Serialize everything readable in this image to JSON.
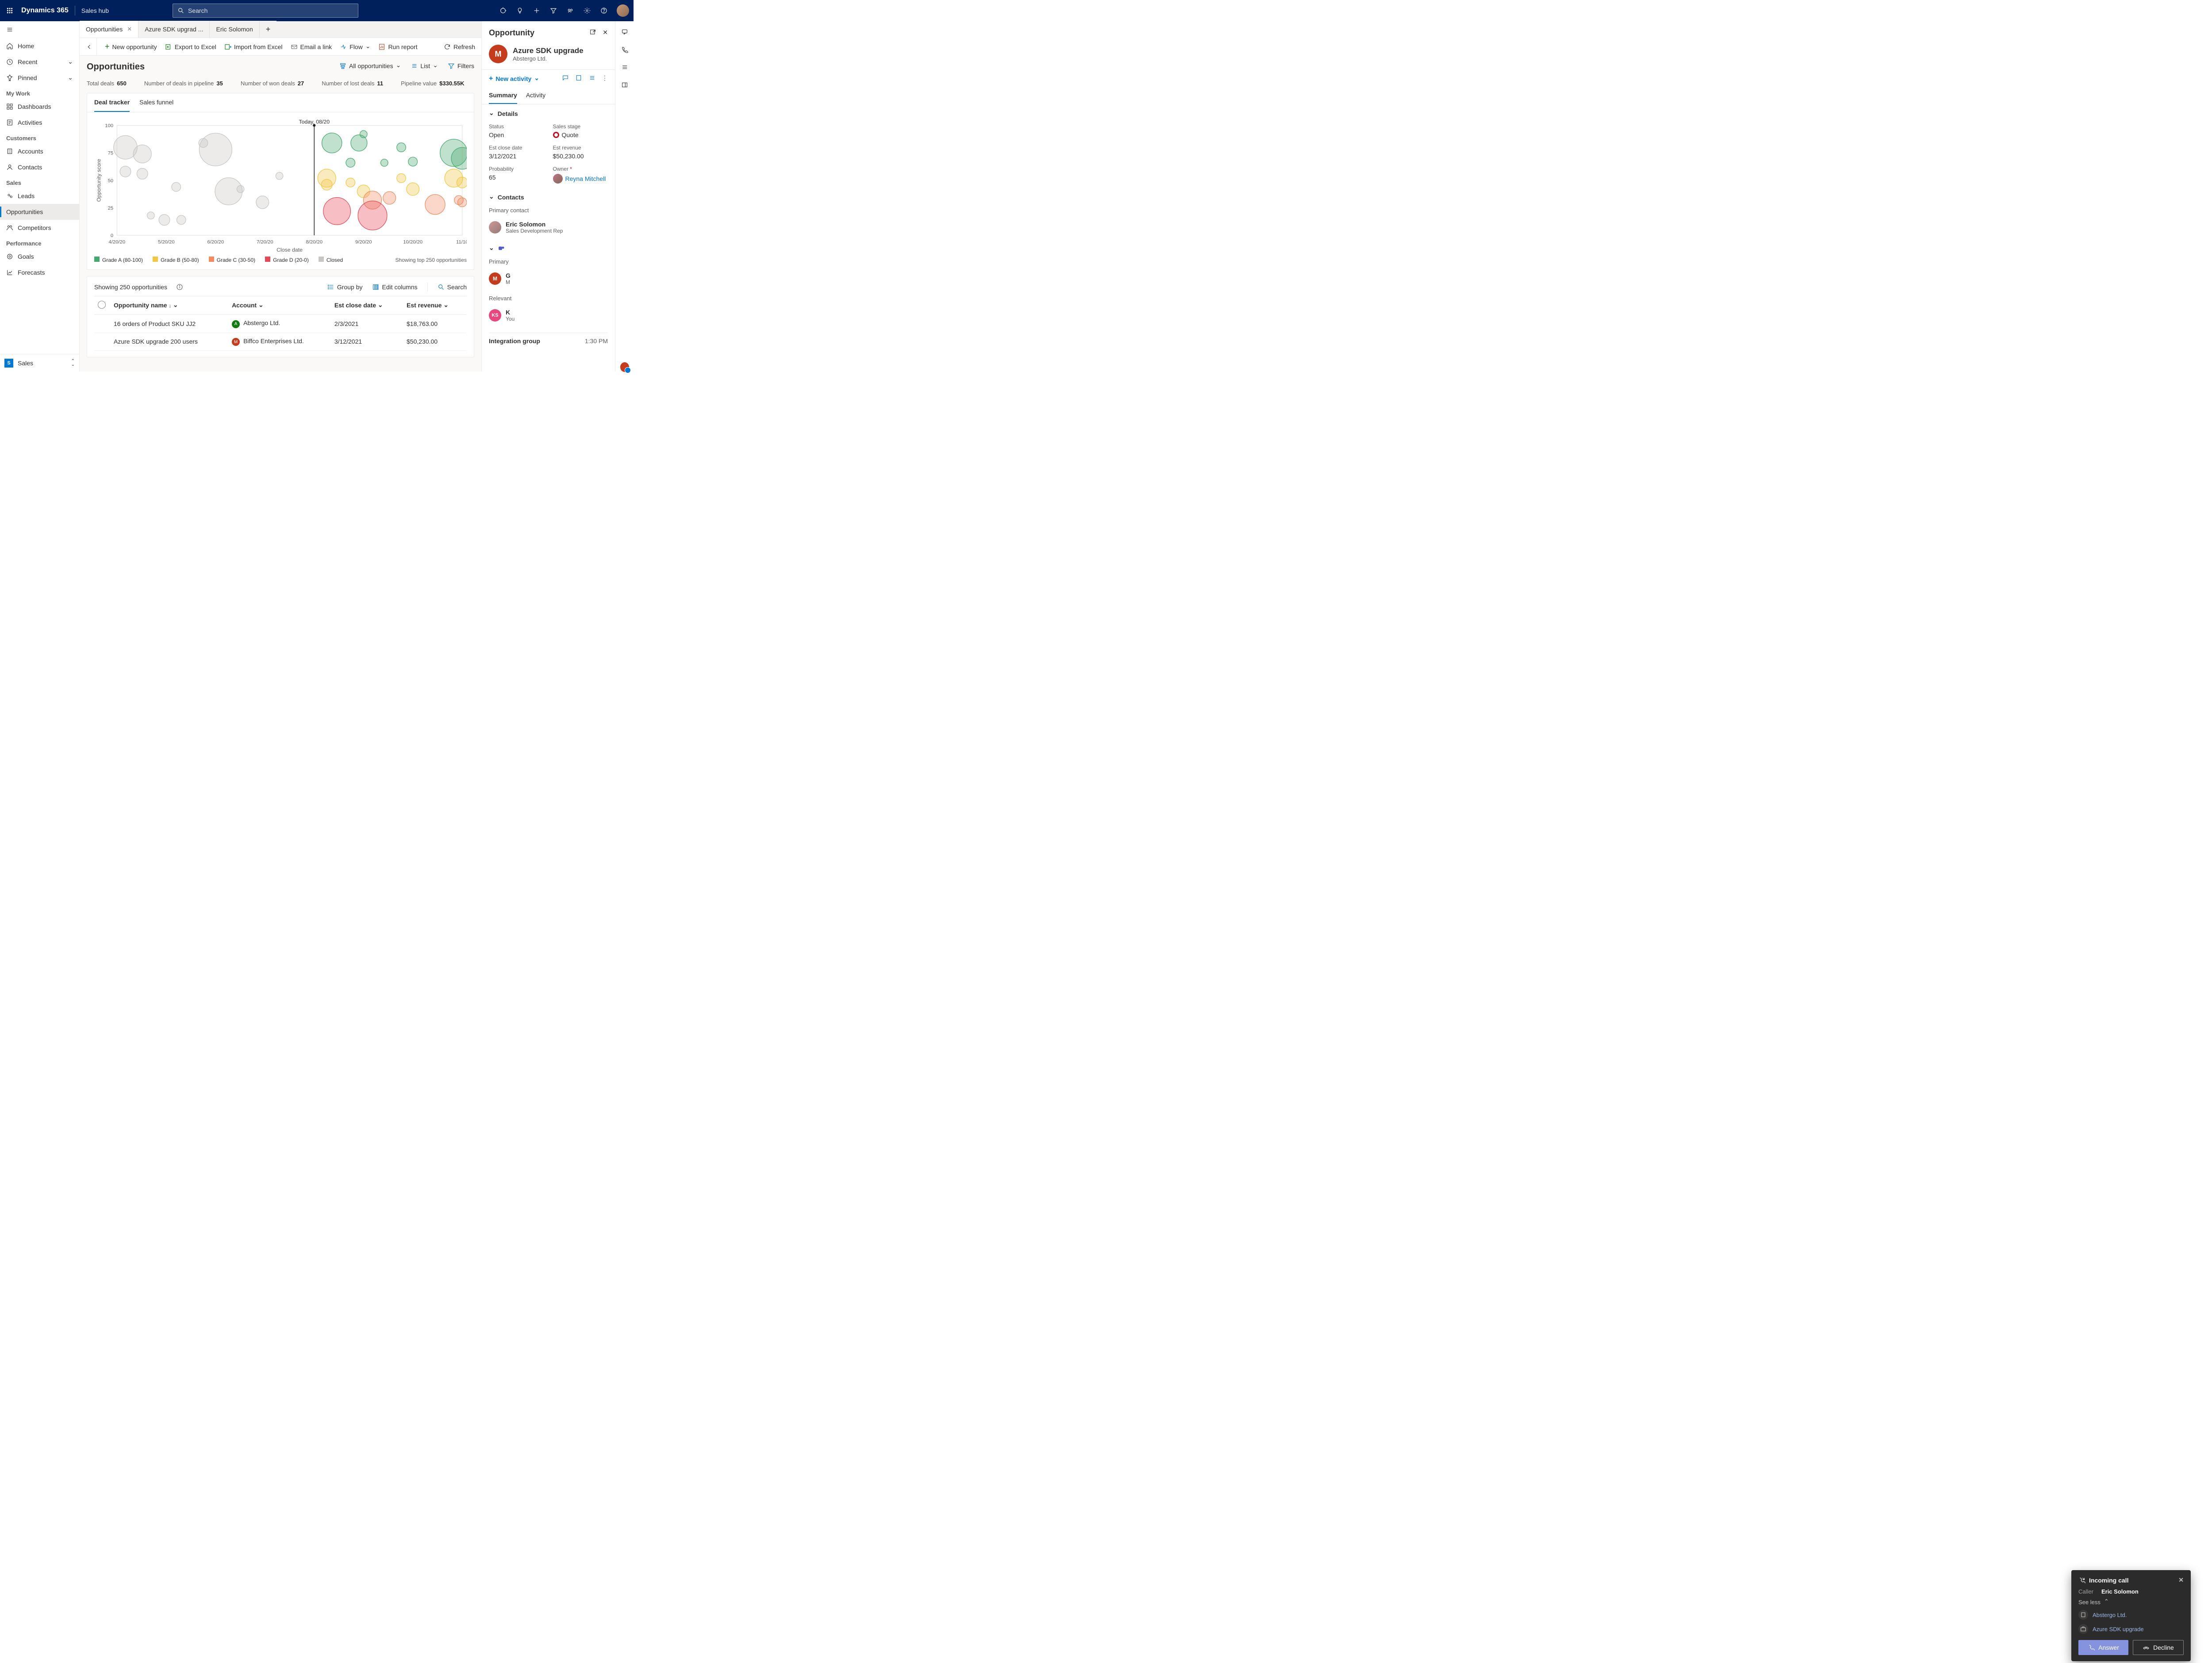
{
  "topnav": {
    "brand": "Dynamics 365",
    "hub": "Sales hub",
    "search_placeholder": "Search"
  },
  "leftnav": {
    "home": "Home",
    "recent": "Recent",
    "pinned": "Pinned",
    "sec_mywork": "My Work",
    "dashboards": "Dashboards",
    "activities": "Activities",
    "sec_customers": "Customers",
    "accounts": "Accounts",
    "contacts": "Contacts",
    "sec_sales": "Sales",
    "leads": "Leads",
    "opportunities": "Opportunities",
    "competitors": "Competitors",
    "sec_performance": "Performance",
    "goals": "Goals",
    "forecasts": "Forecasts",
    "switcher_letter": "S",
    "switcher_label": "Sales"
  },
  "tabs": {
    "t0": "Opportunities",
    "t1": "Azure SDK upgrad ...",
    "t2": "Eric Solomon"
  },
  "cmd": {
    "new": "New opportunity",
    "export": "Export to Excel",
    "import": "Import from Excel",
    "email": "Email a link",
    "flow": "Flow",
    "report": "Run report",
    "refresh": "Refresh"
  },
  "view": {
    "title": "Opportunities",
    "allopps": "All opportunities",
    "list": "List",
    "filters": "Filters"
  },
  "metrics": {
    "total_l": "Total deals",
    "total_v": "650",
    "pipe_l": "Number of deals in pipeline",
    "pipe_v": "35",
    "won_l": "Number of won deals",
    "won_v": "27",
    "lost_l": "Number of lost deals",
    "lost_v": "11",
    "pv_l": "Pipeline value",
    "pv_v": "$330.55K"
  },
  "chart_tabs": {
    "deal": "Deal tracker",
    "funnel": "Sales funnel"
  },
  "chart_data": {
    "type": "scatter",
    "xlabel": "Close date",
    "ylabel": "Opportunity score",
    "x_ticks": [
      "4/20/20",
      "5/20/20",
      "6/20/20",
      "7/20/20",
      "8/20/20",
      "9/20/20",
      "10/20/20",
      "11/10"
    ],
    "y_ticks": [
      0,
      25,
      50,
      75,
      100
    ],
    "ylim": [
      0,
      100
    ],
    "today_marker": "Today, 08/20",
    "series": [
      {
        "name": "Grade A (80-100)",
        "color": "#47a96f",
        "points": [
          {
            "x": "8/25/20",
            "y": 84,
            "r": 22
          },
          {
            "x": "9/10/20",
            "y": 84,
            "r": 18
          },
          {
            "x": "9/20/20",
            "y": 92,
            "r": 8
          },
          {
            "x": "9/05/20",
            "y": 66,
            "r": 10
          },
          {
            "x": "9/25/20",
            "y": 66,
            "r": 8
          },
          {
            "x": "10/05/20",
            "y": 80,
            "r": 10
          },
          {
            "x": "10/20/20",
            "y": 67,
            "r": 10
          },
          {
            "x": "11/05/20",
            "y": 75,
            "r": 30
          },
          {
            "x": "11/10",
            "y": 70,
            "r": 24
          }
        ]
      },
      {
        "name": "Grade B (50-80)",
        "color": "#f2c744",
        "points": [
          {
            "x": "8/22/20",
            "y": 52,
            "r": 20
          },
          {
            "x": "8/22/20",
            "y": 46,
            "r": 12
          },
          {
            "x": "9/05/20",
            "y": 48,
            "r": 10
          },
          {
            "x": "9/20/20",
            "y": 40,
            "r": 14
          },
          {
            "x": "10/05/20",
            "y": 52,
            "r": 10
          },
          {
            "x": "10/20/20",
            "y": 42,
            "r": 14
          },
          {
            "x": "11/05/20",
            "y": 52,
            "r": 20
          },
          {
            "x": "11/10",
            "y": 48,
            "r": 12
          }
        ]
      },
      {
        "name": "Grade C (30-50)",
        "color": "#f28c60",
        "points": [
          {
            "x": "9/18/20",
            "y": 32,
            "r": 20
          },
          {
            "x": "9/28/20",
            "y": 34,
            "r": 14
          },
          {
            "x": "10/25/20",
            "y": 28,
            "r": 22
          },
          {
            "x": "11/08/20",
            "y": 32,
            "r": 10
          },
          {
            "x": "11/10",
            "y": 30,
            "r": 10
          }
        ]
      },
      {
        "name": "Grade D (20-0)",
        "color": "#e74856",
        "points": [
          {
            "x": "8/28/20",
            "y": 22,
            "r": 30
          },
          {
            "x": "9/18/20",
            "y": 18,
            "r": 32
          }
        ]
      },
      {
        "name": "Closed",
        "color": "#c8c6c4",
        "points": [
          {
            "x": "4/25/20",
            "y": 80,
            "r": 26
          },
          {
            "x": "4/25/20",
            "y": 58,
            "r": 12
          },
          {
            "x": "5/05/20",
            "y": 74,
            "r": 20
          },
          {
            "x": "5/05/20",
            "y": 56,
            "r": 12
          },
          {
            "x": "5/25/20",
            "y": 44,
            "r": 10
          },
          {
            "x": "5/10/20",
            "y": 18,
            "r": 8
          },
          {
            "x": "5/18/20",
            "y": 14,
            "r": 12
          },
          {
            "x": "5/28/20",
            "y": 14,
            "r": 10
          },
          {
            "x": "6/10/20",
            "y": 84,
            "r": 10
          },
          {
            "x": "6/20/20",
            "y": 78,
            "r": 36
          },
          {
            "x": "6/25/20",
            "y": 40,
            "r": 30
          },
          {
            "x": "7/02/20",
            "y": 42,
            "r": 8
          },
          {
            "x": "7/15/20",
            "y": 30,
            "r": 14
          },
          {
            "x": "7/25/20",
            "y": 54,
            "r": 8
          }
        ]
      }
    ],
    "footer_note": "Showing top 250 opportunities"
  },
  "gridbar": {
    "showing": "Showing 250 opportunities",
    "groupby": "Group by",
    "editcols": "Edit columns",
    "search": "Search"
  },
  "grid": {
    "h_name": "Opportunity name",
    "h_account": "Account",
    "h_close": "Est close date",
    "h_rev": "Est revenue",
    "rows": [
      {
        "name": "16 orders of Product SKU JJ2",
        "account": "Abstergo Ltd.",
        "close": "2/3/2021",
        "rev": "$18,763.00",
        "logo": "green"
      },
      {
        "name": "Azure SDK upgrade 200 users",
        "account": "Biffco Enterprises Ltd.",
        "close": "3/12/2021",
        "rev": "$50,230.00",
        "logo": "red"
      }
    ]
  },
  "rpanel": {
    "heading": "Opportunity",
    "name": "Azure SDK upgrade",
    "sub": "Abstergo Ltd.",
    "newactivity": "New activity",
    "pv_summary": "Summary",
    "pv_activity": "Activity",
    "sec_details": "Details",
    "status_l": "Status",
    "status_v": "Open",
    "stage_l": "Sales stage",
    "stage_v": "Quote",
    "close_l": "Est close date",
    "close_v": "3/12/2021",
    "rev_l": "Est revenue",
    "rev_v": "$50,230.00",
    "prob_l": "Probability",
    "prob_v": "65",
    "owner_l": "Owner",
    "owner_req": "*",
    "owner_v": "Reyna Mitchell",
    "sec_contacts": "Contacts",
    "primcontact_l": "Primary contact",
    "contact_name": "Eric Solomon",
    "contact_title": "Sales Development Rep",
    "prim_l": "Primary",
    "acc_l": "G",
    "acc_sub": "M",
    "relevant_l": "Relevant",
    "relevant_name": "K",
    "relevant_you": "You",
    "ig_label": "Integration group",
    "time": "1:30 PM"
  },
  "call": {
    "title": "Incoming call",
    "caller_l": "Caller",
    "caller_v": "Eric Solomon",
    "seeless": "See less",
    "rel1": "Abstergo Ltd.",
    "rel2": "Azure SDK upgrade",
    "answer": "Answer",
    "decline": "Decline"
  }
}
